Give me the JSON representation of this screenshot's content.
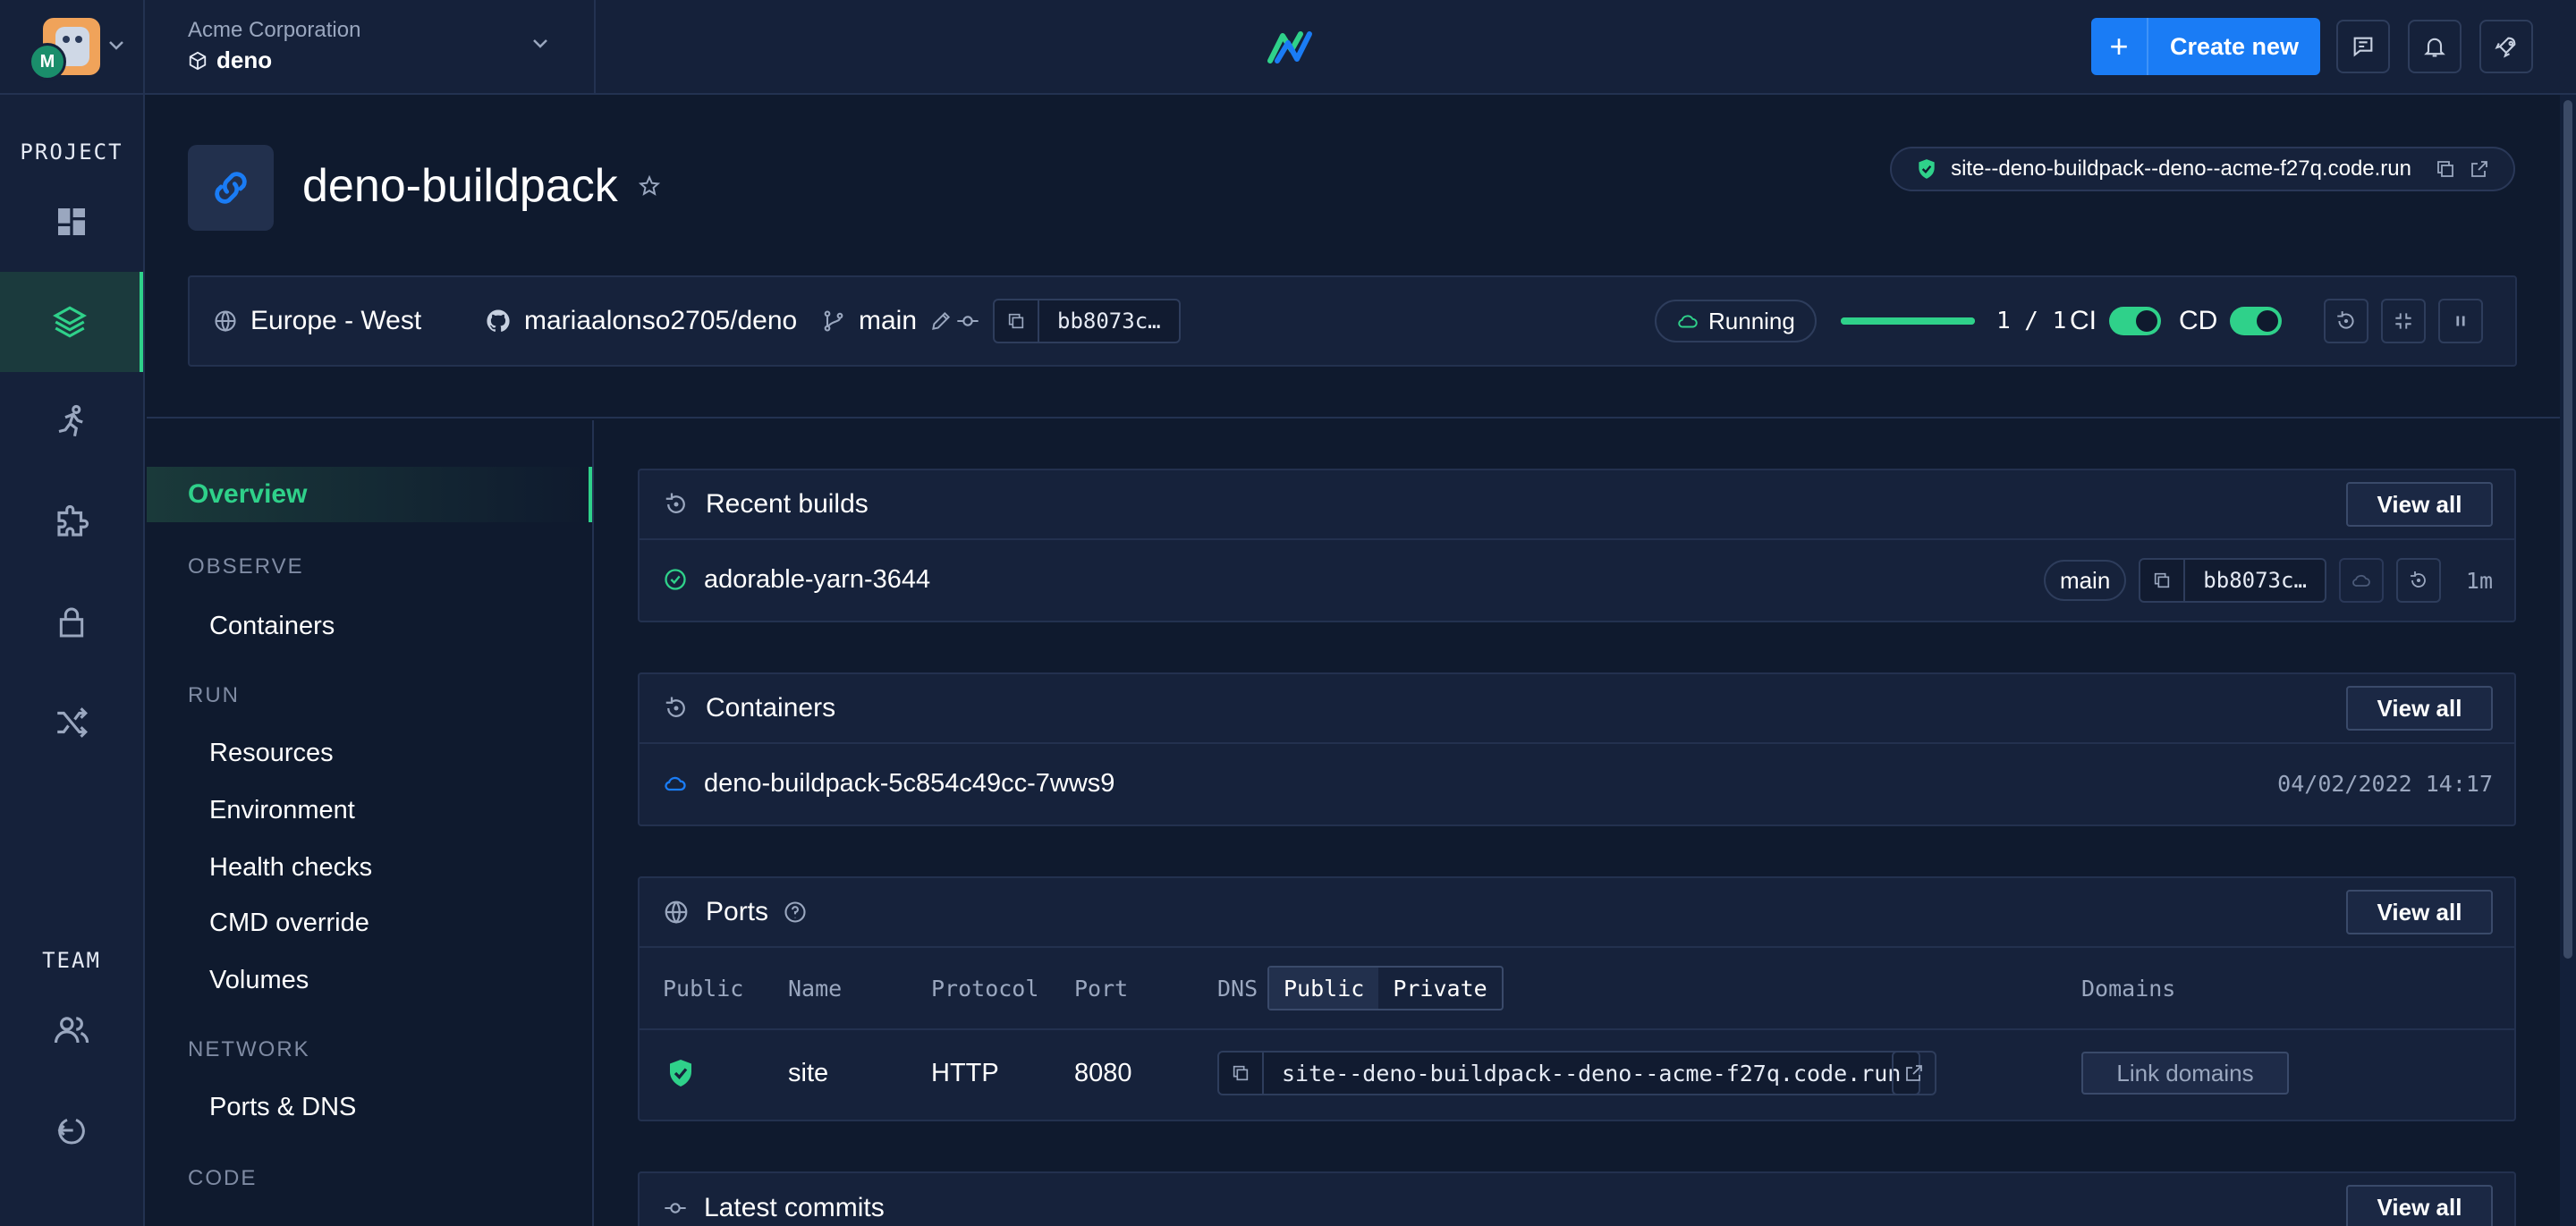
{
  "topbar": {
    "avatar_initial": "M",
    "org_name": "Acme Corporation",
    "project_name": "deno",
    "create_label": "Create new",
    "create_plus": "+"
  },
  "rail": {
    "project_label": "PROJECT",
    "team_label": "TEAM",
    "items": [
      "dashboard-icon",
      "layers-icon",
      "runner-icon",
      "puzzle-icon",
      "lock-icon",
      "shuffle-icon"
    ]
  },
  "service": {
    "name": "deno-buildpack",
    "dns": "site--deno-buildpack--deno--acme-f27q.code.run",
    "region": "Europe - West",
    "repo": "mariaalonso2705/deno",
    "branch": "main",
    "commit": "bb8073c…",
    "status": "Running",
    "instances": "1 / 1",
    "instances_fraction": 1.0,
    "ci_label": "CI",
    "cd_label": "CD",
    "ci_enabled": true,
    "cd_enabled": true
  },
  "subnav": {
    "overview": "Overview",
    "observe": "OBSERVE",
    "containers": "Containers",
    "run": "RUN",
    "resources": "Resources",
    "environment": "Environment",
    "health_checks": "Health checks",
    "cmd_override": "CMD override",
    "volumes": "Volumes",
    "network": "NETWORK",
    "ports_dns": "Ports & DNS",
    "code": "CODE"
  },
  "builds": {
    "title": "Recent builds",
    "view_all": "View all",
    "item": {
      "name": "adorable-yarn-3644",
      "branch": "main",
      "commit": "bb8073c…",
      "age": "1m"
    }
  },
  "containers": {
    "title": "Containers",
    "view_all": "View all",
    "item": {
      "name": "deno-buildpack-5c854c49cc-7wws9",
      "time": "04/02/2022 14:17"
    }
  },
  "ports": {
    "title": "Ports",
    "view_all": "View all",
    "headers": {
      "public": "Public",
      "name": "Name",
      "protocol": "Protocol",
      "port": "Port",
      "dns": "DNS",
      "dns_public": "Public",
      "dns_private": "Private",
      "domains": "Domains"
    },
    "row": {
      "name": "site",
      "protocol": "HTTP",
      "port": "8080",
      "dns": "site--deno-buildpack--deno--acme-f27q.code.run",
      "link_domains": "Link domains"
    }
  },
  "commits": {
    "title": "Latest commits",
    "view_all": "View all"
  },
  "colors": {
    "bg": "#0f1a2e",
    "panel": "#16223b",
    "accent_green": "#2fd18a",
    "accent_blue": "#1a7cf5"
  }
}
